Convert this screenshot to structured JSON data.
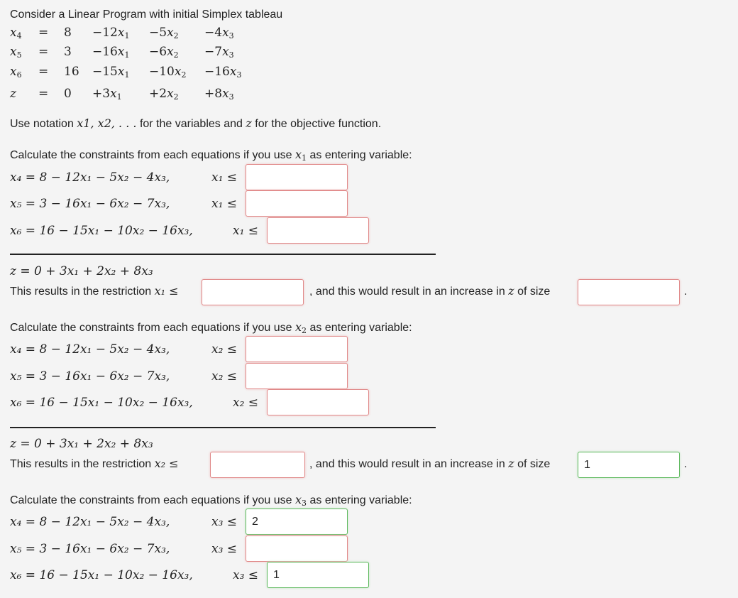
{
  "header": {
    "intro": "Consider a Linear Program with initial Simplex tableau",
    "notation_prefix": "Use notation",
    "notation_vars": "x1, x2, . . .",
    "notation_mid": "for the variables and",
    "notation_z": "z",
    "notation_suffix": "for the objective function."
  },
  "tableau": {
    "rows": [
      {
        "lhs": "x",
        "lhs_sub": "4",
        "eq": "=",
        "c": "8",
        "t1": "−12x",
        "t1s": "1",
        "t2": "−5x",
        "t2s": "2",
        "t3": "−4x",
        "t3s": "3"
      },
      {
        "lhs": "x",
        "lhs_sub": "5",
        "eq": "=",
        "c": "3",
        "t1": "−16x",
        "t1s": "1",
        "t2": "−6x",
        "t2s": "2",
        "t3": "−7x",
        "t3s": "3"
      },
      {
        "lhs": "x",
        "lhs_sub": "6",
        "eq": "=",
        "c": "16",
        "t1": "−15x",
        "t1s": "1",
        "t2": "−10x",
        "t2s": "2",
        "t3": "−16x",
        "t3s": "3"
      },
      {
        "lhs": "z",
        "lhs_sub": "",
        "eq": "=",
        "c": "0",
        "t1": "+3x",
        "t1s": "1",
        "t2": "+2x",
        "t2s": "2",
        "t3": "+8x",
        "t3s": "3"
      }
    ]
  },
  "sections": [
    {
      "heading_pre": "Calculate the constraints from each equations if you use",
      "var": "x",
      "var_sub": "1",
      "heading_post": "as entering variable:",
      "eqs": [
        "x₄ = 8 − 12x₁ − 5x₂ − 4x₃,",
        "x₅ = 3 − 16x₁ − 6x₂ − 7x₃,",
        "x₆ = 16 − 15x₁ − 10x₂ − 16x₃,"
      ],
      "bound_label": "x₁ ≤",
      "inputs": [
        "",
        "",
        ""
      ],
      "z_eq": "z = 0 + 3x₁ + 2x₂ + 8x₃",
      "restriction_pre": "This results in the restriction",
      "restriction_var": "x₁ ≤",
      "restriction_value": "",
      "increase_text": ", and this would result in an increase in",
      "increase_z": "z",
      "increase_post": "of size",
      "increase_value": "",
      "period": "."
    },
    {
      "heading_pre": "Calculate the constraints from each equations if you use",
      "var": "x",
      "var_sub": "2",
      "heading_post": "as entering variable:",
      "eqs": [
        "x₄ = 8 − 12x₁ − 5x₂ − 4x₃,",
        "x₅ = 3 − 16x₁ − 6x₂ − 7x₃,",
        "x₆ = 16 − 15x₁ − 10x₂ − 16x₃,"
      ],
      "bound_label": "x₂ ≤",
      "inputs": [
        "",
        "",
        ""
      ],
      "z_eq": "z = 0 + 3x₁ + 2x₂ + 8x₃",
      "restriction_pre": "This results in the restriction",
      "restriction_var": "x₂ ≤",
      "restriction_value": "",
      "increase_text": ", and this would result in an increase in",
      "increase_z": "z",
      "increase_post": "of size",
      "increase_value": "1",
      "period": "."
    },
    {
      "heading_pre": "Calculate the constraints from each equations if you use",
      "var": "x",
      "var_sub": "3",
      "heading_post": "as entering variable:",
      "eqs": [
        "x₄ = 8 − 12x₁ − 5x₂ − 4x₃,",
        "x₅ = 3 − 16x₁ − 6x₂ − 7x₃,",
        "x₆ = 16 − 15x₁ − 10x₂ − 16x₃,"
      ],
      "bound_label": "x₃ ≤",
      "inputs": [
        "2",
        "",
        "1"
      ]
    }
  ],
  "colors": {
    "correct_border": "#5cb85c",
    "incorrect_border": "#e08888",
    "background": "#f4f4f4"
  }
}
